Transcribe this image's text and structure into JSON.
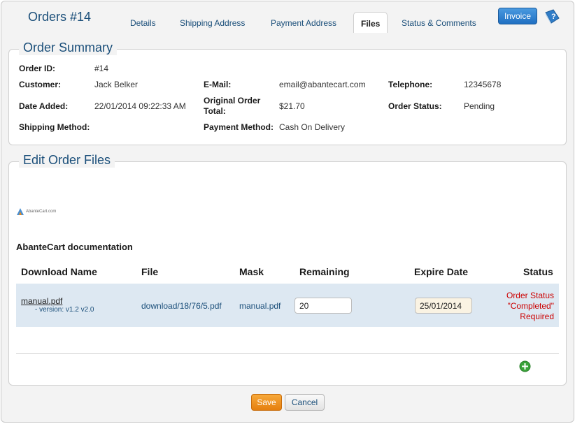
{
  "header": {
    "title": "Orders #14",
    "tabs": [
      {
        "label": "Details"
      },
      {
        "label": "Shipping Address"
      },
      {
        "label": "Payment Address"
      },
      {
        "label": "Files"
      },
      {
        "label": "Status & Comments"
      }
    ],
    "active_tab": "Files",
    "invoice_label": "Invoice",
    "help_icon": "help-book-icon"
  },
  "summary": {
    "title": "Order Summary",
    "order_id_label": "Order ID:",
    "order_id": "#14",
    "customer_label": "Customer:",
    "customer": "Jack Belker",
    "email_label": "E-Mail:",
    "email": "email@abantecart.com",
    "telephone_label": "Telephone:",
    "telephone": "12345678",
    "date_added_label": "Date Added:",
    "date_added": "22/01/2014 09:22:33 AM",
    "original_total_label_line1": "Original Order",
    "original_total_label_line2": "Total:",
    "original_total": "$21.70",
    "order_status_label": "Order Status:",
    "order_status": "Pending",
    "shipping_method_label": "Shipping Method:",
    "shipping_method": "",
    "payment_method_label": "Payment Method:",
    "payment_method": "Cash On Delivery"
  },
  "files": {
    "title": "Edit Order Files",
    "logo_text": "AbanteCart.com",
    "product_name": "AbanteCart documentation",
    "columns": [
      "Download Name",
      "File",
      "Mask",
      "Remaining",
      "Expire Date",
      "Status"
    ],
    "rows": [
      {
        "name": "manual.pdf",
        "version": "- version: v1.2 v2.0",
        "file": "download/18/76/5.pdf",
        "mask": "manual.pdf",
        "remaining": "20",
        "expire_date": "25/01/2014",
        "status_line1": "Order Status",
        "status_line2": "\"Completed\"",
        "status_line3": "Required"
      }
    ],
    "add_icon": "plus-circle-icon"
  },
  "actions": {
    "save_label": "Save",
    "cancel_label": "Cancel"
  },
  "colors": {
    "accent": "#1b4f7a",
    "row_highlight": "#dde8f2",
    "status_red": "#cc0000",
    "save_orange": "#f08c1a",
    "invoice_blue": "#2a7fd0"
  }
}
